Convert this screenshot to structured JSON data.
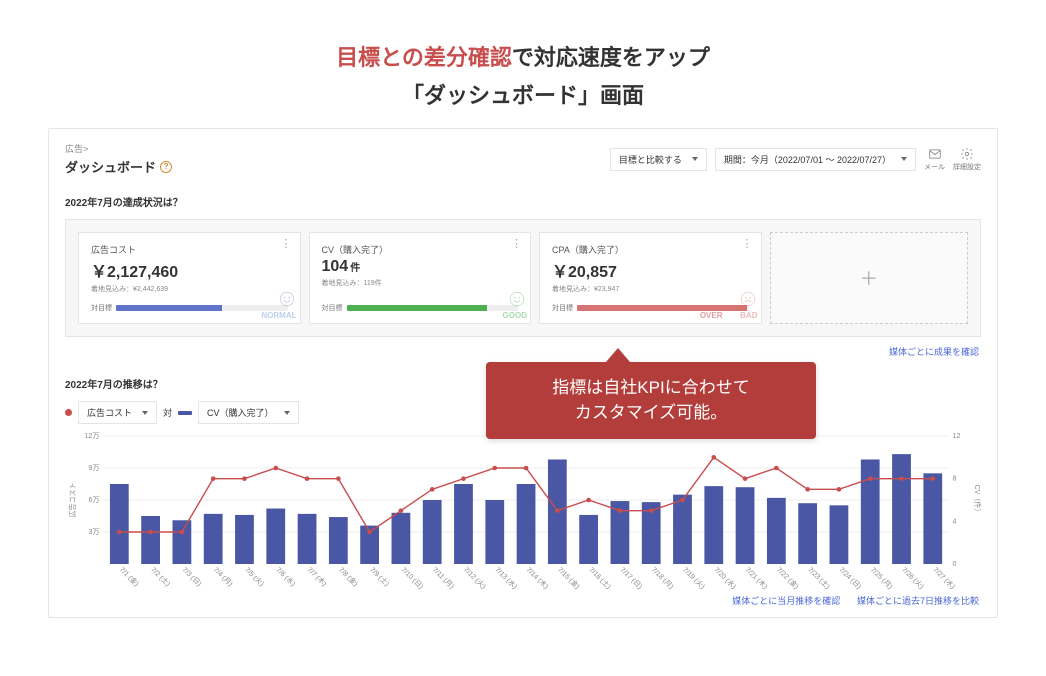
{
  "hero": {
    "highlight": "目標との差分確認",
    "rest": "で対応速度をアップ",
    "line2": "「ダッシュボード」画面"
  },
  "breadcrumb": "広告>",
  "page_title": "ダッシュボード",
  "toolbar": {
    "compare": "目標と比較する",
    "period": "期間：今月（2022/07/01 〜 2022/07/27）",
    "mail": "メール",
    "settings": "詳細設定"
  },
  "section_status": "2022年7月の達成状況は？",
  "cards": [
    {
      "label": "広告コスト",
      "value": "￥2,127,460",
      "unit": "",
      "sub": "着地見込み：¥2,442,639",
      "barlabel": "対目標",
      "bar_pct": 62,
      "bar_color": "#5f74c8",
      "watermark": "NORMAL",
      "wm_class": "normal",
      "face": "smile"
    },
    {
      "label": "CV（購入完了）",
      "value": "104",
      "unit": "件",
      "sub": "着地見込み：119件",
      "barlabel": "対目標",
      "bar_pct": 82,
      "bar_color": "#4caf50",
      "watermark": "GOOD",
      "wm_class": "good",
      "face": "smile"
    },
    {
      "label": "CPA（購入完了）",
      "value": "￥20,857",
      "unit": "",
      "sub": "着地見込み：¥23,947",
      "barlabel": "対目標",
      "bar_pct": 99,
      "bar_color": "#d67474",
      "watermark": "BAD",
      "wm_class": "bad",
      "over": "OVER",
      "face": "sad"
    }
  ],
  "link_detail": "媒体ごとに成果を確認",
  "section_trend": "2022年7月の推移は？",
  "legend": {
    "cost": "広告コスト",
    "vs": "対",
    "cv": "CV（購入完了）"
  },
  "callout": {
    "l1": "指標は自社KPIに合わせて",
    "l2": "カスタマイズ可能。"
  },
  "bottom_links": {
    "a": "媒体ごとに当月推移を確認",
    "b": "媒体ごとに過去7日推移を比較"
  },
  "chart_data": {
    "type": "bar+line",
    "title": "",
    "xlabel": "",
    "ylabel_left": "広告コスト",
    "ylabel_right": "CV（件）",
    "left_ticks": [
      "3万",
      "6万",
      "9万",
      "12万"
    ],
    "left_tick_values": [
      30000,
      60000,
      90000,
      120000
    ],
    "right_ticks": [
      "0",
      "4",
      "8",
      "12"
    ],
    "right_tick_values": [
      0,
      4,
      8,
      12
    ],
    "categories": [
      "7/1 (金)",
      "7/2 (土)",
      "7/3 (日)",
      "7/4 (月)",
      "7/5 (火)",
      "7/6 (水)",
      "7/7 (木)",
      "7/8 (金)",
      "7/9 (土)",
      "7/10 (日)",
      "7/11 (月)",
      "7/12 (火)",
      "7/13 (水)",
      "7/14 (木)",
      "7/15 (金)",
      "7/16 (土)",
      "7/17 (日)",
      "7/18 (月)",
      "7/19 (火)",
      "7/20 (水)",
      "7/21 (木)",
      "7/22 (金)",
      "7/23 (土)",
      "7/24 (日)",
      "7/25 (月)",
      "7/26 (火)",
      "7/27 (水)"
    ],
    "series": [
      {
        "name": "広告コスト",
        "kind": "bar",
        "values": [
          75000,
          45000,
          41000,
          47000,
          46000,
          52000,
          47000,
          44000,
          36000,
          48000,
          60000,
          75000,
          60000,
          75000,
          98000,
          46000,
          59000,
          58000,
          65000,
          73000,
          72000,
          62000,
          57000,
          55000,
          98000,
          103000,
          85000
        ]
      },
      {
        "name": "CV（購入完了）",
        "kind": "line",
        "values": [
          3,
          3,
          3,
          8,
          8,
          9,
          8,
          8,
          3,
          5,
          7,
          8,
          9,
          9,
          5,
          6,
          5,
          5,
          6,
          10,
          8,
          9,
          7,
          7,
          8,
          8,
          8
        ]
      }
    ],
    "ylim_left": [
      0,
      120000
    ],
    "ylim_right": [
      0,
      12
    ]
  }
}
